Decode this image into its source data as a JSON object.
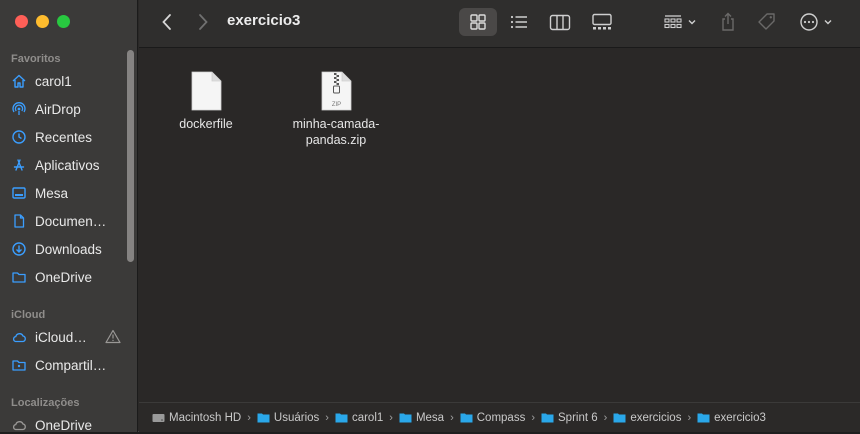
{
  "toolbar": {
    "title": "exercicio3"
  },
  "sidebar": {
    "favorites_title": "Favoritos",
    "favorites": [
      {
        "label": "carol1",
        "icon": "home-icon"
      },
      {
        "label": "AirDrop",
        "icon": "airdrop-icon"
      },
      {
        "label": "Recentes",
        "icon": "clock-icon"
      },
      {
        "label": "Aplicativos",
        "icon": "applications-icon"
      },
      {
        "label": "Mesa",
        "icon": "desktop-icon"
      },
      {
        "label": "Documen…",
        "icon": "document-icon"
      },
      {
        "label": "Downloads",
        "icon": "download-icon"
      },
      {
        "label": "OneDrive",
        "icon": "folder-icon"
      }
    ],
    "icloud_title": "iCloud",
    "icloud": [
      {
        "label": "iCloud…",
        "icon": "cloud-icon"
      },
      {
        "label": "Compartil…",
        "icon": "shared-folder-icon"
      }
    ],
    "locations_title": "Localizações",
    "locations": [
      {
        "label": "OneDrive",
        "icon": "cloud-icon"
      }
    ]
  },
  "files": [
    {
      "name": "dockerfile",
      "kind": "document"
    },
    {
      "name": "minha-camada-pandas.zip",
      "kind": "zip",
      "line1": "minha-camada-",
      "line2": "pandas.zip",
      "badge": "ZIP"
    }
  ],
  "pathbar": {
    "items": [
      "Macintosh HD",
      "Usuários",
      "carol1",
      "Mesa",
      "Compass",
      "Sprint 6",
      "exercicios",
      "exercicio3"
    ],
    "separator": "›"
  },
  "colors": {
    "accent": "#3b9eff",
    "close": "#fe5f57",
    "minimize": "#febc2e",
    "maximize": "#28c840",
    "folder": "#2aa7e9"
  }
}
